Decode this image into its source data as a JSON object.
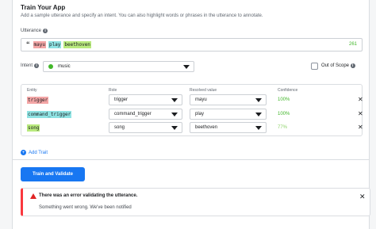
{
  "header": {
    "title": "Train Your App",
    "subtitle": "Add a sample utterance and specify an intent. You can also highlight words or phrases in the utterance to annotate."
  },
  "utterance": {
    "label": "Utterance",
    "quote_glyph": "“",
    "tokens": [
      {
        "text": "mayu",
        "color": "#f4a6a6"
      },
      {
        "text": "play",
        "color": "#8fe3e3"
      },
      {
        "text": "beethoven",
        "color": "#b9ea7e"
      }
    ],
    "char_count": "261"
  },
  "intent": {
    "label": "Intent",
    "value": "music",
    "dot_color": "#42b72a",
    "out_of_scope_label": "Out of Scope",
    "out_of_scope_checked": false
  },
  "entities": {
    "headers": {
      "entity": "Entity",
      "role": "Role",
      "resolved": "Resolved value",
      "confidence": "Confidence"
    },
    "rows": [
      {
        "entity": "trigger",
        "entity_color": "#f4a6a6",
        "role": "trigger",
        "resolved": "mayu",
        "confidence": "100%",
        "conf_color": "#42b72a"
      },
      {
        "entity": "command_trigger",
        "entity_color": "#8fe3e3",
        "role": "command_trigger",
        "resolved": "play",
        "confidence": "100%",
        "conf_color": "#42b72a"
      },
      {
        "entity": "song",
        "entity_color": "#b9ea7e",
        "role": "song",
        "resolved": "beethoven",
        "confidence": "77%",
        "conf_color": "#8fd36b"
      }
    ],
    "remove_glyph": "✕"
  },
  "add_trait": {
    "label": "Add Trait",
    "plus_glyph": "+"
  },
  "actions": {
    "train_label": "Train and Validate"
  },
  "error": {
    "title": "There was an error validating the utterance.",
    "message": "Something went wrong. We've been notified",
    "close_glyph": "✕",
    "accent": "#fa383e"
  },
  "icons": {
    "info": "i"
  }
}
